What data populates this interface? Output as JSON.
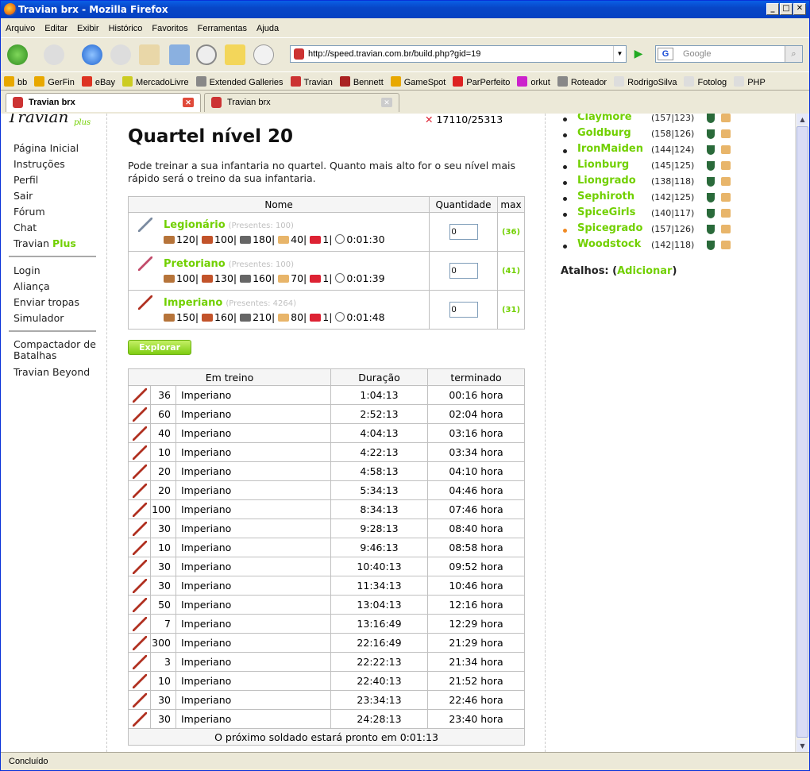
{
  "window": {
    "title": "Travian brx - Mozilla Firefox"
  },
  "menu": [
    "Arquivo",
    "Editar",
    "Exibir",
    "Histórico",
    "Favoritos",
    "Ferramentas",
    "Ajuda"
  ],
  "url": "http://speed.travian.com.br/build.php?gid=19",
  "search_placeholder": "Google",
  "bookmarks": [
    "bb",
    "GerFin",
    "eBay",
    "MercadoLivre",
    "Extended Galleries",
    "Travian",
    "Bennett",
    "GameSpot",
    "ParPerfeito",
    "orkut",
    "Roteador",
    "RodrigoSilva",
    "Fotolog",
    "PHP"
  ],
  "tabs": [
    {
      "label": "Travian brx"
    },
    {
      "label": "Travian brx"
    }
  ],
  "status": "Concluído",
  "logo": {
    "sub": "plus"
  },
  "sidebar": {
    "group1": [
      "Página Inicial",
      "Instruções",
      "Perfil",
      "Sair",
      "Fórum",
      "Chat"
    ],
    "travian_plus_a": "Travian ",
    "travian_plus_b": "Plus",
    "group2": [
      "Login",
      "Aliança",
      "Enviar tropas",
      "Simulador"
    ],
    "group3_a": "Compactador de",
    "group3_b": "Batalhas",
    "group3_c": "Travian Beyond"
  },
  "resource": "17110/25313",
  "page_title": "Quartel nível 20",
  "description": "Pode treinar a sua infantaria no quartel. Quanto mais alto for o seu nível mais rápido será o treino da sua infantaria.",
  "train_table": {
    "headers": [
      "Nome",
      "Quantidade",
      "max"
    ],
    "units": [
      {
        "name": "Legionário",
        "present": "(Presentes: 100)",
        "wood": "120",
        "clay": "100",
        "iron": "180",
        "crop": "40",
        "upkeep": "1",
        "time": "0:01:30",
        "qty": "0",
        "max": "(36)"
      },
      {
        "name": "Pretoriano",
        "present": "(Presentes: 100)",
        "wood": "100",
        "clay": "130",
        "iron": "160",
        "crop": "70",
        "upkeep": "1",
        "time": "0:01:39",
        "qty": "0",
        "max": "(41)"
      },
      {
        "name": "Imperiano",
        "present": "(Presentes: 4264)",
        "wood": "150",
        "clay": "160",
        "iron": "210",
        "crop": "80",
        "upkeep": "1",
        "time": "0:01:48",
        "qty": "0",
        "max": "(31)"
      }
    ]
  },
  "explorar_label": "Explorar",
  "training_table": {
    "headers": [
      "Em treino",
      "Duração",
      "terminado"
    ],
    "rows": [
      {
        "n": "36",
        "unit": "Imperiano",
        "dur": "1:04:13",
        "end": "00:16 hora"
      },
      {
        "n": "60",
        "unit": "Imperiano",
        "dur": "2:52:13",
        "end": "02:04 hora"
      },
      {
        "n": "40",
        "unit": "Imperiano",
        "dur": "4:04:13",
        "end": "03:16 hora"
      },
      {
        "n": "10",
        "unit": "Imperiano",
        "dur": "4:22:13",
        "end": "03:34 hora"
      },
      {
        "n": "20",
        "unit": "Imperiano",
        "dur": "4:58:13",
        "end": "04:10 hora"
      },
      {
        "n": "20",
        "unit": "Imperiano",
        "dur": "5:34:13",
        "end": "04:46 hora"
      },
      {
        "n": "100",
        "unit": "Imperiano",
        "dur": "8:34:13",
        "end": "07:46 hora"
      },
      {
        "n": "30",
        "unit": "Imperiano",
        "dur": "9:28:13",
        "end": "08:40 hora"
      },
      {
        "n": "10",
        "unit": "Imperiano",
        "dur": "9:46:13",
        "end": "08:58 hora"
      },
      {
        "n": "30",
        "unit": "Imperiano",
        "dur": "10:40:13",
        "end": "09:52 hora"
      },
      {
        "n": "30",
        "unit": "Imperiano",
        "dur": "11:34:13",
        "end": "10:46 hora"
      },
      {
        "n": "50",
        "unit": "Imperiano",
        "dur": "13:04:13",
        "end": "12:16 hora"
      },
      {
        "n": "7",
        "unit": "Imperiano",
        "dur": "13:16:49",
        "end": "12:29 hora"
      },
      {
        "n": "300",
        "unit": "Imperiano",
        "dur": "22:16:49",
        "end": "21:29 hora"
      },
      {
        "n": "3",
        "unit": "Imperiano",
        "dur": "22:22:13",
        "end": "21:34 hora"
      },
      {
        "n": "10",
        "unit": "Imperiano",
        "dur": "22:40:13",
        "end": "21:52 hora"
      },
      {
        "n": "30",
        "unit": "Imperiano",
        "dur": "23:34:13",
        "end": "22:46 hora"
      },
      {
        "n": "30",
        "unit": "Imperiano",
        "dur": "24:28:13",
        "end": "23:40 hora"
      }
    ],
    "footer": "O próximo soldado estará pronto em 0:01:13"
  },
  "villages": [
    {
      "name": "Claymore",
      "coord": "(157|123)"
    },
    {
      "name": "Goldburg",
      "coord": "(158|126)"
    },
    {
      "name": "IronMaiden",
      "coord": "(144|124)"
    },
    {
      "name": "Lionburg",
      "coord": "(145|125)"
    },
    {
      "name": "Liongrado",
      "coord": "(138|118)"
    },
    {
      "name": "Sephiroth",
      "coord": "(142|125)"
    },
    {
      "name": "SpiceGirls",
      "coord": "(140|117)"
    },
    {
      "name": "Spicegrado",
      "coord": "(157|126)",
      "active": true
    },
    {
      "name": "Woodstock",
      "coord": "(142|118)"
    }
  ],
  "atalhos": {
    "label": "Atalhos:",
    "link": "Adicionar"
  },
  "colors": {
    "green": "#71d000",
    "active_dot": "#f08a24"
  }
}
